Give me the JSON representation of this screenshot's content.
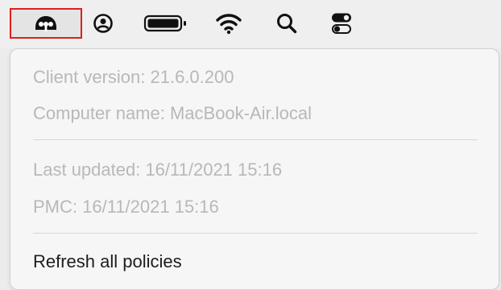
{
  "menubar": {
    "items": [
      {
        "icon": "app-agent-icon",
        "selected": true
      },
      {
        "icon": "user-circle-icon"
      },
      {
        "icon": "battery-icon"
      },
      {
        "icon": "wifi-icon"
      },
      {
        "icon": "search-icon"
      },
      {
        "icon": "control-center-icon"
      }
    ],
    "highlight_color": "#e01e1e"
  },
  "menu": {
    "client_version": "Client version: 21.6.0.200",
    "computer_name": "Computer name: MacBook-Air.local",
    "last_updated": "Last updated: 16/11/2021 15:16",
    "pmc": "PMC: 16/11/2021 15:16",
    "refresh_all_policies": "Refresh all policies"
  },
  "colors": {
    "disabled_text": "#b8b8b8",
    "enabled_text": "#1d1d1d"
  }
}
